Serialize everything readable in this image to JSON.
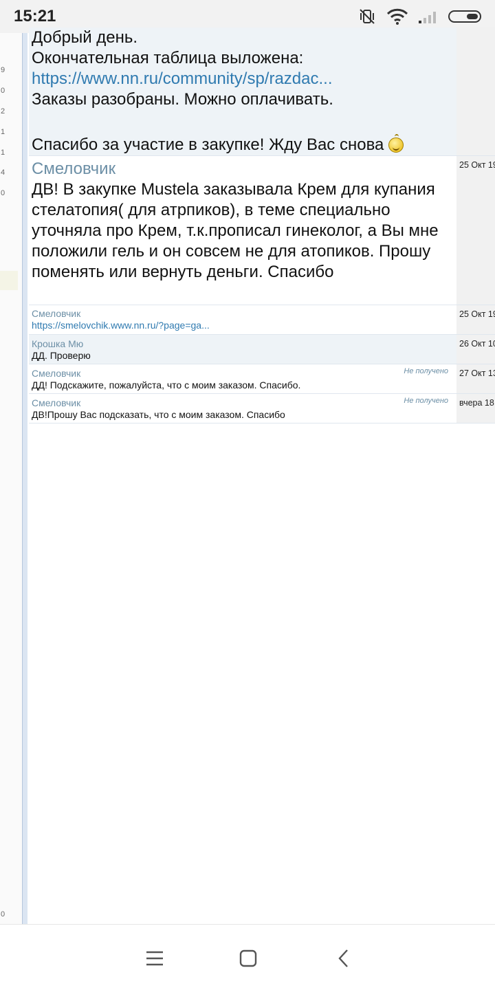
{
  "status_bar": {
    "time": "15:21",
    "icons": [
      "mute-vibrate-icon",
      "wifi-icon",
      "signal-icon",
      "battery-icon"
    ]
  },
  "left_column": {
    "numbers": [
      "9",
      "0",
      "2",
      "1",
      "1",
      "4",
      "0",
      "0"
    ]
  },
  "messages": [
    {
      "id": "partial",
      "lines_top": [
        "Добрый день.",
        "Окончательная таблица выложена:"
      ],
      "link": "https://www.nn.ru/community/sp/razdac...",
      "line_after_link": "Заказы разобраны. Можно оплачивать.",
      "closing": "Спасибо за участие в закупке! Жду Вас снова"
    },
    {
      "id": "m1",
      "author": "Смеловчик",
      "text": "ДВ! В закупке Mustela заказывала Крем для купания стелатопия( для атрпиков), в теме специально уточняла про Крем, т.к.прописал гинеколог, а Вы мне положили гель и он совсем не для атопиков. Прошу поменять или вернуть деньги. Спасибо",
      "date": "25 Окт 19"
    },
    {
      "id": "m2",
      "author": "Смеловчик",
      "link": "https://smelovchik.www.nn.ru/?page=ga...",
      "date": "25 Окт 19"
    },
    {
      "id": "m3",
      "author": "Крошка Мю",
      "text": "ДД. Проверю",
      "date": "26 Окт 10"
    },
    {
      "id": "m4",
      "author": "Смеловчик",
      "status": "Не получено",
      "text": "ДД! Подскажите, пожалуйста, что с моим заказом. Спасибо.",
      "date": "27 Окт 13"
    },
    {
      "id": "m5",
      "author": "Смеловчик",
      "status": "Не получено",
      "text": "ДВ!Прошу Вас подсказать, что с моим заказом. Спасибо",
      "date": "вчера 18:"
    }
  ],
  "nav_bar": {
    "icons": [
      "menu-icon",
      "home-icon",
      "back-icon"
    ]
  }
}
